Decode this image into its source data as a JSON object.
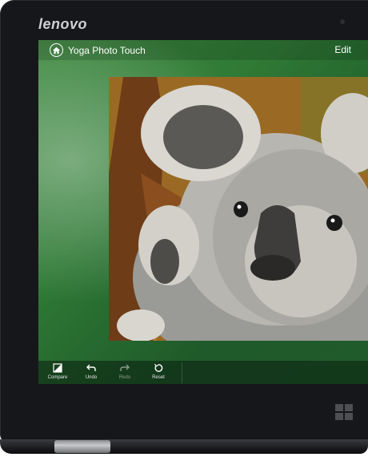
{
  "device": {
    "brand": "lenovo"
  },
  "app": {
    "title": "Yoga Photo Touch",
    "edit_label": "Edit"
  },
  "toolbar": {
    "items": [
      {
        "label": "Compare",
        "icon": "compare-icon",
        "enabled": true
      },
      {
        "label": "Undo",
        "icon": "undo-icon",
        "enabled": true
      },
      {
        "label": "Redo",
        "icon": "redo-icon",
        "enabled": false
      },
      {
        "label": "Reset",
        "icon": "reset-icon",
        "enabled": true
      }
    ]
  },
  "colors": {
    "bezel": "#16171a",
    "screen_accent": "#2f7a35",
    "text": "#ffffff"
  }
}
